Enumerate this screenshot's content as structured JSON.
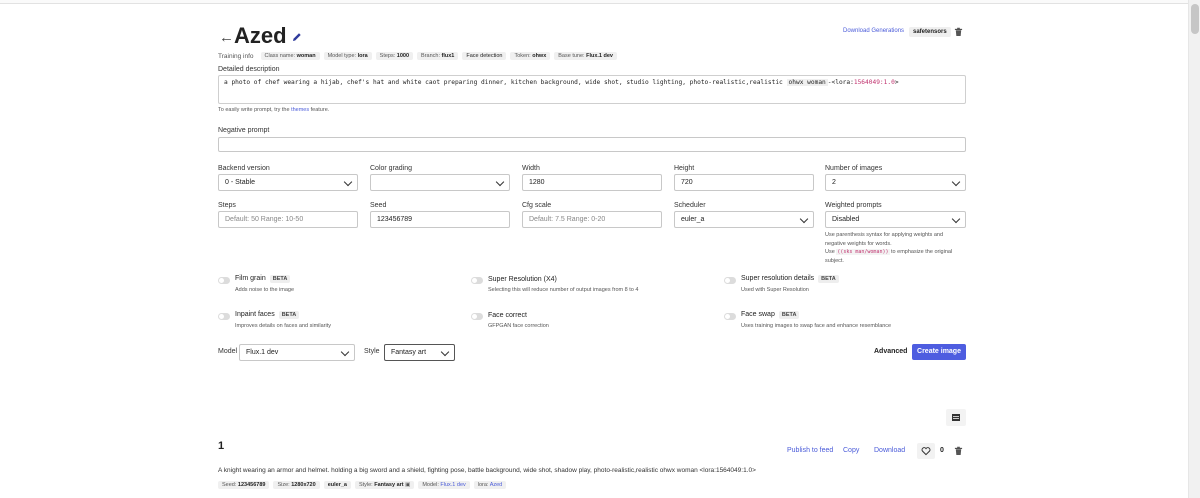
{
  "header": {
    "title": "Azed",
    "download_generations": "Download Generations",
    "safetensors": "safetensors"
  },
  "training_info": {
    "label": "Training info",
    "chips": [
      {
        "key": "Class name:",
        "value": "woman"
      },
      {
        "key": "Model type:",
        "value": "lora"
      },
      {
        "key": "Steps:",
        "value": "1000"
      },
      {
        "key": "Branch:",
        "value": "flux1"
      },
      {
        "key": "",
        "value": "Face detection"
      },
      {
        "key": "Token:",
        "value": "ohwx"
      },
      {
        "key": "Base tune:",
        "value": "Flux.1 dev"
      }
    ]
  },
  "description": {
    "label": "Detailed description",
    "prompt_text": "a photo of  chef wearing a hijab, chef's hat and white caot preparing dinner, kitchen background, wide shot, studio lighting, photo-realistic,realistic ",
    "token_tag": "ohwx woman",
    "lora_prefix": "-<lora:",
    "lora_value": "1564049:1.0",
    "lora_suffix": ">",
    "hint_before": "To easily write prompt, try the ",
    "hint_link": "themes",
    "hint_after": " feature."
  },
  "negative_prompt": {
    "label": "Negative prompt",
    "value": ""
  },
  "fields_row1": {
    "backend_label": "Backend version",
    "backend_value": "0 - Stable",
    "color_label": "Color grading",
    "color_value": "",
    "width_label": "Width",
    "width_value": "1280",
    "height_label": "Height",
    "height_value": "720",
    "num_images_label": "Number of images",
    "num_images_value": "2"
  },
  "fields_row2": {
    "steps_label": "Steps",
    "steps_placeholder": "Default: 50 Range: 10-50",
    "seed_label": "Seed",
    "seed_value": "123456789",
    "cfg_label": "Cfg scale",
    "cfg_placeholder": "Default: 7.5 Range: 0-20",
    "scheduler_label": "Scheduler",
    "scheduler_value": "euler_a",
    "weighted_label": "Weighted prompts",
    "weighted_value": "Disabled",
    "weighted_help1": "Use parenthesis syntax for applying weights and negative weights for words.",
    "weighted_help2_pre": "Use ",
    "weighted_help2_code": "((sks man/woman))",
    "weighted_help2_post": " to emphasize the original subject."
  },
  "toggles": {
    "beta": "BETA",
    "film_grain": {
      "name": "Film grain",
      "desc": "Adds noise to the image"
    },
    "super_resolution": {
      "name": "Super Resolution (X4)",
      "desc": "Selecting this will reduce number of output images from 8 to 4"
    },
    "super_resolution_details": {
      "name": "Super resolution details",
      "desc": "Used with Super Resolution"
    },
    "inpaint_faces": {
      "name": "Inpaint faces",
      "desc": "Improves details on faces and similarity"
    },
    "face_correct": {
      "name": "Face correct",
      "desc": "GFPGAN face correction"
    },
    "face_swap": {
      "name": "Face swap",
      "desc": "Uses training images to swap face and enhance resemblance"
    }
  },
  "bottom_controls": {
    "model_label": "Model",
    "model_value": "Flux.1 dev",
    "style_label": "Style",
    "style_value": "Fantasy art",
    "advanced": "Advanced",
    "create_image": "Create image"
  },
  "generation": {
    "number": "1",
    "publish": "Publish to feed",
    "copy": "Copy",
    "download": "Download",
    "likes": "0",
    "prompt": "A knight wearing an armor and helmet. holding a big sword and a shield, fighting pose, battle background, wide shot, shadow play, photo-realistic,realistic  ohwx woman <lora:1564049:1.0>",
    "meta": {
      "seed_key": "Seed:",
      "seed": "123456789",
      "size_key": "Size:",
      "size": "1280x720",
      "scheduler": "euler_a",
      "style_key": "Style:",
      "style": "Fantasy art",
      "model_key": "Model:",
      "model": "Flux.1 dev",
      "lora_key": "lora:",
      "lora": "Azed"
    }
  },
  "colors": {
    "accent": "#4e5de0",
    "link": "#4a5bd9"
  }
}
